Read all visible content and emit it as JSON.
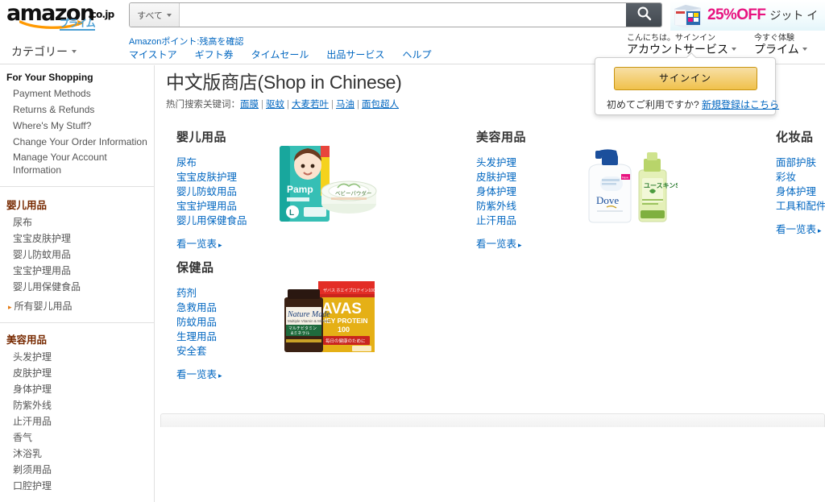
{
  "header": {
    "logo": {
      "brand": "amazon",
      "tld": ".co.jp",
      "prime": "プライム"
    },
    "search": {
      "category": "すべて",
      "value": "",
      "placeholder": "",
      "button_icon": "search-icon"
    },
    "promo": {
      "percent": "25%OFF",
      "text": "ジット イ"
    },
    "category_menu": "カテゴリー",
    "points_link": "Amazonポイント:残高を確認",
    "nav_links": [
      {
        "label": "マイストア"
      },
      {
        "label": "ギフト券"
      },
      {
        "label": "タイムセール"
      },
      {
        "label": "出品サービス"
      },
      {
        "label": "ヘルプ"
      }
    ],
    "account": {
      "greeting": "こんにちは。サインイン",
      "label": "アカウントサービス"
    },
    "prime": {
      "greeting": "今すぐ体験",
      "label": "プライム"
    }
  },
  "signin_flyout": {
    "button": "サインイン",
    "note_prefix": "初めてご利用ですか? ",
    "note_link": "新規登録はこちら"
  },
  "sidebar": {
    "shopping": {
      "title": "For Your Shopping",
      "items": [
        {
          "label": "Payment Methods"
        },
        {
          "label": "Returns & Refunds"
        },
        {
          "label": "Where's My Stuff?"
        },
        {
          "label": "Change Your Order Information"
        },
        {
          "label": "Manage Your Account Information"
        }
      ]
    },
    "baby": {
      "title": "婴儿用品",
      "items": [
        {
          "label": "尿布"
        },
        {
          "label": "宝宝皮肤护理"
        },
        {
          "label": "婴儿防蚊用品"
        },
        {
          "label": "宝宝护理用品"
        },
        {
          "label": "婴儿用保健食品"
        }
      ],
      "all_label": "所有婴儿用品"
    },
    "beauty": {
      "title": "美容用品",
      "items": [
        {
          "label": "头发护理"
        },
        {
          "label": "皮肤护理"
        },
        {
          "label": "身体护理"
        },
        {
          "label": "防紫外线"
        },
        {
          "label": "止汗用品"
        },
        {
          "label": "香气"
        },
        {
          "label": "沐浴乳"
        },
        {
          "label": "剃须用品"
        },
        {
          "label": "口腔护理"
        }
      ]
    }
  },
  "main": {
    "title": "中文版商店(Shop in Chinese)",
    "hot_label": "热门搜索关键词：",
    "hot_keywords": [
      {
        "label": "面膜"
      },
      {
        "label": "驱蚊"
      },
      {
        "label": "大麦若叶"
      },
      {
        "label": "马油"
      },
      {
        "label": "面包超人"
      }
    ],
    "more_label": "看一览表",
    "categories": [
      {
        "heading": "婴儿用品",
        "links": [
          {
            "label": "尿布"
          },
          {
            "label": "宝宝皮肤护理"
          },
          {
            "label": "婴儿防蚊用品"
          },
          {
            "label": "宝宝护理用品"
          },
          {
            "label": "婴儿用保健食品"
          }
        ],
        "image_alt": "diapers-and-baby-powder"
      },
      {
        "heading": "美容用品",
        "links": [
          {
            "label": "头发护理"
          },
          {
            "label": "皮肤护理"
          },
          {
            "label": "身体护理"
          },
          {
            "label": "防紫外线"
          },
          {
            "label": "止汗用品"
          }
        ],
        "image_alt": "body-wash-and-lotion"
      },
      {
        "heading": "化妆品",
        "links": [
          {
            "label": "面部护肤"
          },
          {
            "label": "彩妆"
          },
          {
            "label": "身体护理"
          },
          {
            "label": "工具和配件"
          }
        ],
        "image_alt": ""
      },
      {
        "heading": "保健品",
        "links": [
          {
            "label": "药剂"
          },
          {
            "label": "急救用品"
          },
          {
            "label": "防蚊用品"
          },
          {
            "label": "生理用品"
          },
          {
            "label": "安全套"
          }
        ],
        "image_alt": "vitamins-and-whey-protein"
      }
    ]
  },
  "colors": {
    "link": "#0066c0",
    "sidebar_heading": "#772900",
    "accent_orange": "#e47911",
    "promo_pink": "#e8127f",
    "signin_gold": "#f0c14b"
  }
}
